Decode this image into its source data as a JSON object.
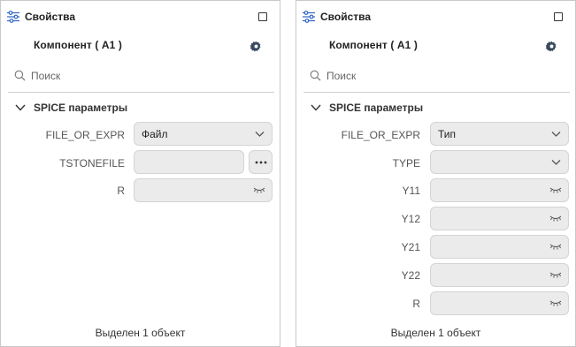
{
  "panels": [
    {
      "title": "Свойства",
      "component_name": "Компонент ( A1 )",
      "search": {
        "placeholder": "Поиск",
        "value": ""
      },
      "group_title": "SPICE параметры",
      "rows": [
        {
          "label": "FILE_OR_EXPR",
          "value": "Файл",
          "control": "dropdown"
        },
        {
          "label": "TSTONEFILE",
          "value": "",
          "control": "file-picker"
        },
        {
          "label": "R",
          "value": "",
          "control": "hidden-field"
        }
      ],
      "status": "Выделен 1 объект"
    },
    {
      "title": "Свойства",
      "component_name": "Компонент ( A1 )",
      "search": {
        "placeholder": "Поиск",
        "value": ""
      },
      "group_title": "SPICE параметры",
      "rows": [
        {
          "label": "FILE_OR_EXPR",
          "value": "Тип",
          "control": "dropdown"
        },
        {
          "label": "TYPE",
          "value": "",
          "control": "dropdown"
        },
        {
          "label": "Y11",
          "value": "",
          "control": "hidden-field"
        },
        {
          "label": "Y12",
          "value": "",
          "control": "hidden-field"
        },
        {
          "label": "Y21",
          "value": "",
          "control": "hidden-field"
        },
        {
          "label": "Y22",
          "value": "",
          "control": "hidden-field"
        },
        {
          "label": "R",
          "value": "",
          "control": "hidden-field"
        }
      ],
      "status": "Выделен 1 объект"
    }
  ],
  "icons": {
    "header": "properties-sliders-icon",
    "maximize": "maximize-icon",
    "component": "gear-icon",
    "search": "search-icon",
    "group": "chevron-down-icon",
    "dropdown": "chevron-down-icon",
    "hidden": "hidden-eye-icon",
    "more": "ellipsis-icon"
  },
  "colors": {
    "field_bg": "#ebebeb",
    "border": "#c9c9c9",
    "text": "#333333",
    "label": "#555555"
  }
}
